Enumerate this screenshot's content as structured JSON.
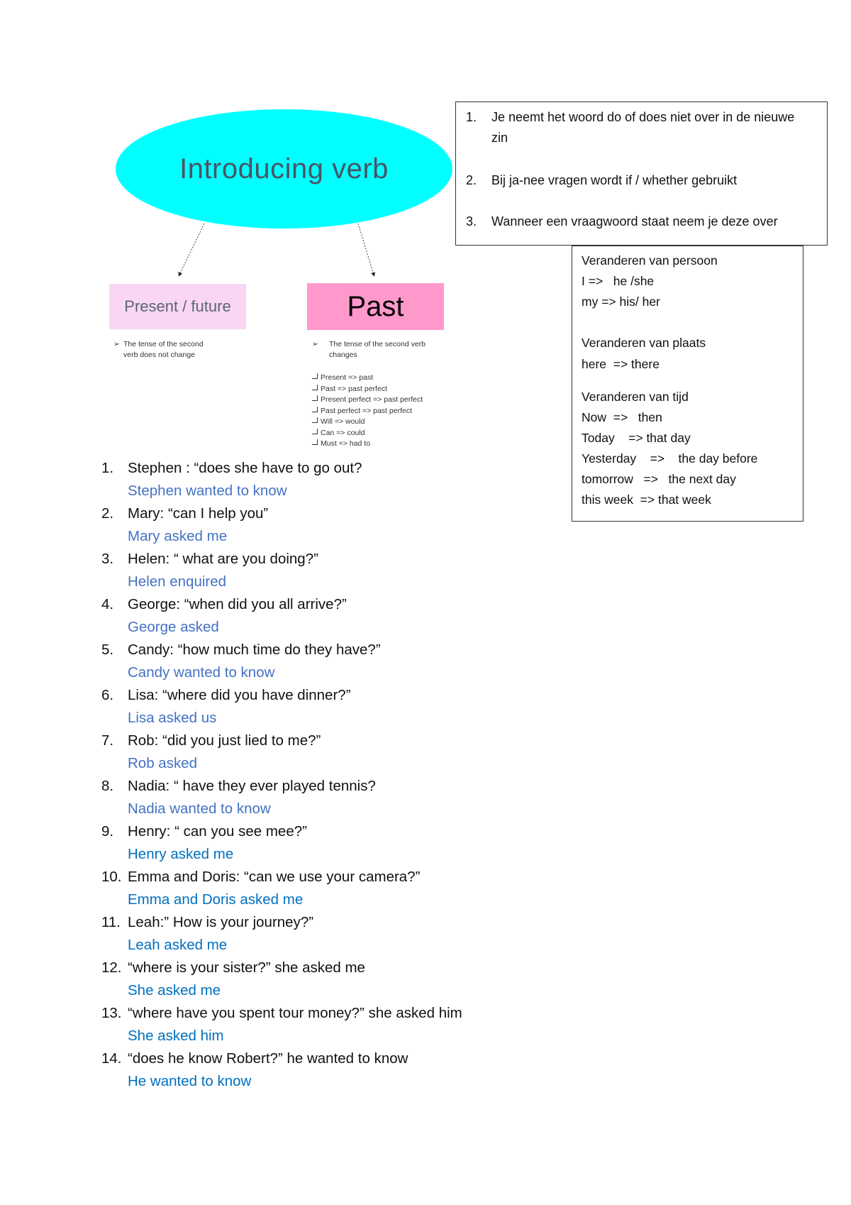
{
  "diagram": {
    "root": "Introducing verb",
    "branches": [
      {
        "label": "Present / future",
        "note": [
          "The tense of the second",
          "verb does not change"
        ]
      },
      {
        "label": "Past",
        "note": [
          "The tense of the second verb",
          "changes"
        ],
        "rules": [
          "Present => past",
          "Past => past perfect",
          "Present perfect => past perfect",
          "Past perfect => past perfect",
          "Will => would",
          "Can => could",
          "Must => had to"
        ]
      }
    ]
  },
  "rules_box": {
    "items": [
      {
        "num": "1.",
        "text": "Je neemt het woord do of does niet over in de nieuwe zin"
      },
      {
        "num": "2.",
        "text": "Bij ja-nee vragen wordt if / whether gebruikt"
      },
      {
        "num": "3.",
        "text": "Wanneer een vraagwoord staat neem je deze over"
      }
    ]
  },
  "changes_box": {
    "lines": [
      "Veranderen van persoon",
      "I =>   he /she",
      "my => his/ her",
      "Veranderen van plaats",
      "here  => there",
      "Veranderen van tijd",
      "Now  =>   then",
      "Today    => that day",
      "Yesterday    =>    the day before",
      "tomorrow   =>   the next day",
      "this week  => that week"
    ]
  },
  "exercises": [
    {
      "num": "1.",
      "question": "Stephen : “does she have to go out?",
      "answer": "Stephen wanted to know"
    },
    {
      "num": "2.",
      "question": "Mary: “can I help you”",
      "answer": "Mary asked me"
    },
    {
      "num": "3.",
      "question": "Helen: “ what are you doing?”",
      "answer": "Helen enquired"
    },
    {
      "num": "4.",
      "question": "George: “when did you all arrive?”",
      "answer": "George asked"
    },
    {
      "num": "5.",
      "question": "Candy: “how much time do they have?”",
      "answer": "Candy wanted to know"
    },
    {
      "num": "6.",
      "question": "Lisa: “where did you have dinner?”",
      "answer": "Lisa asked us"
    },
    {
      "num": "7.",
      "question": "Rob: “did you just lied to me?”",
      "answer": "Rob asked"
    },
    {
      "num": "8.",
      "question": "Nadia: “ have they ever played tennis?",
      "answer": "Nadia wanted to know"
    },
    {
      "num": "9.",
      "question": "Henry: “ can you see mee?”",
      "answer": "Henry asked me"
    },
    {
      "num": "10.",
      "question": "Emma and Doris: “can we use your camera?”",
      "answer": "Emma and Doris asked me"
    },
    {
      "num": "11.",
      "question": "Leah:” How is your journey?”",
      "answer": "Leah asked me"
    },
    {
      "num": "12.",
      "question": "“where is your sister?” she asked me",
      "answer": "She asked me"
    },
    {
      "num": "13.",
      "question": "“where have you spent tour money?” she asked him",
      "answer": "She asked him"
    },
    {
      "num": "14.",
      "question": "“does he know Robert?” he wanted to know",
      "answer": "He wanted to know"
    }
  ],
  "colors": {
    "ellipse": "#00ffff",
    "present_box": "#f9d6f2",
    "past_box": "#ff99cc",
    "answer_blue": "#4472c4",
    "answer_blue_alt": "#0070c0"
  }
}
